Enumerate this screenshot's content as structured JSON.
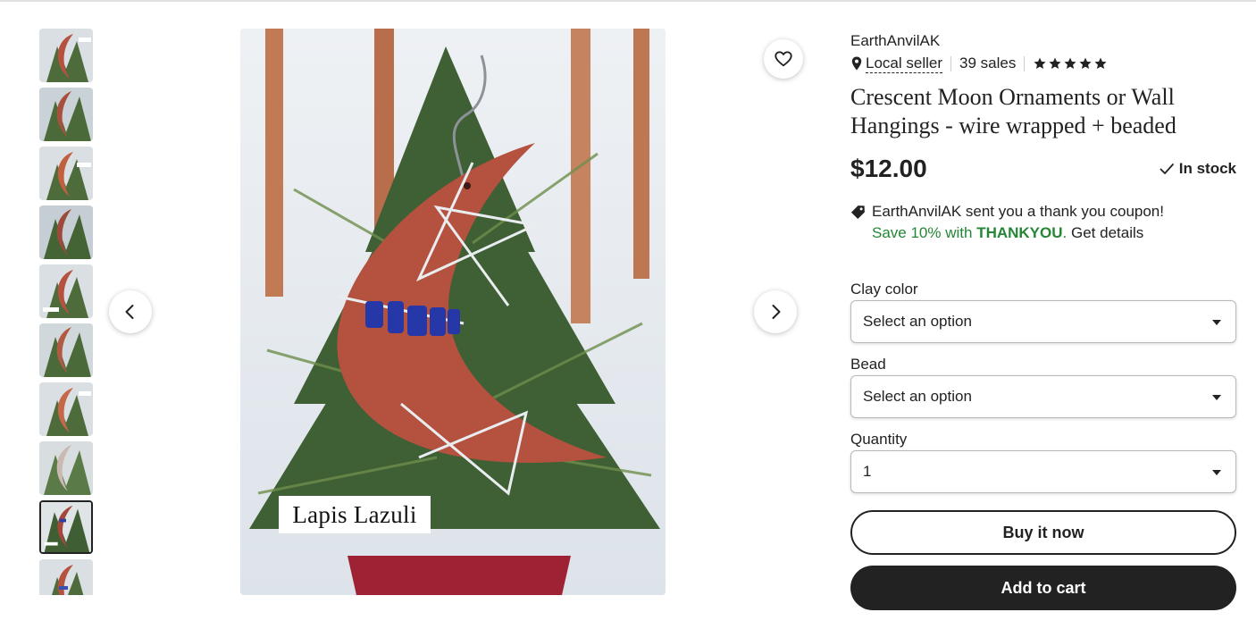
{
  "gallery": {
    "thumbnail_count": 10,
    "selected_index": 8,
    "main_image_caption": "Lapis Lazuli",
    "icons": {
      "prev": "chevron-left-icon",
      "next": "chevron-right-icon",
      "favorite": "heart-icon"
    }
  },
  "listing": {
    "shop_name": "EarthAnvilAK",
    "local_seller": "Local seller",
    "sales": "39 sales",
    "rating_stars": 5,
    "title": "Crescent Moon Ornaments or Wall Hangings - wire wrapped + beaded",
    "price": "$12.00",
    "stock": "In stock",
    "coupon": {
      "message": "EarthAnvilAK sent you a thank you coupon!",
      "save_text": "Save 10% with ",
      "code": "THANKYOU",
      "period": ".",
      "details_link": "Get details"
    }
  },
  "options": {
    "clay_color": {
      "label": "Clay color",
      "value": "Select an option"
    },
    "bead": {
      "label": "Bead",
      "value": "Select an option"
    },
    "quantity": {
      "label": "Quantity",
      "value": "1"
    }
  },
  "actions": {
    "buy_now": "Buy it now",
    "add_to_cart": "Add to cart"
  },
  "colors": {
    "clay": "#b4523f",
    "accent_green": "#258635",
    "button_dark": "#222222"
  }
}
